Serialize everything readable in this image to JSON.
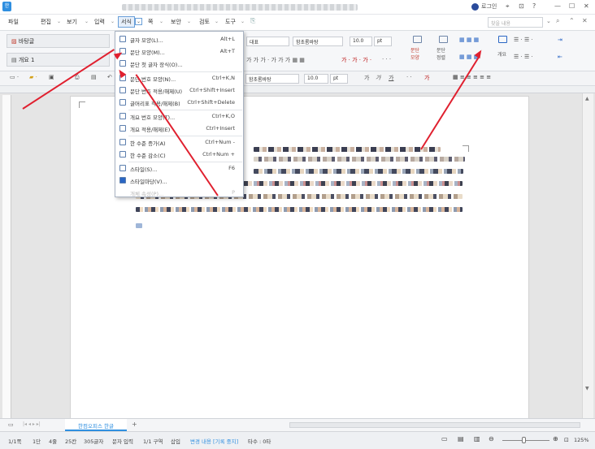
{
  "titlebar": {
    "login_label": "로그인"
  },
  "menu": {
    "items": [
      "파일",
      "편집",
      "보기",
      "입력",
      "서식",
      "쪽",
      "보안",
      "검토",
      "도구"
    ],
    "active": "서식",
    "search_placeholder": "찾을 내용"
  },
  "ribbon": {
    "style_1": "바탕글",
    "style_2": "개요 1",
    "style_name_field": "대표",
    "font_field": "함초롬바탕",
    "size_field": "10.0",
    "size_unit": "pt",
    "paragraph_btn": "문단\n모양",
    "align_btn": "문단\n정렬",
    "outline_btn": "개요",
    "tb2_font": "함초롬바탕",
    "tb2_size": "10.0",
    "tb2_unit": "pt",
    "text_ga": "가"
  },
  "dropdown": {
    "items": [
      {
        "label": "글자 모양(L)...",
        "shortcut": "Alt+L"
      },
      {
        "label": "문단 모양(M)...",
        "shortcut": "Alt+T"
      },
      {
        "label": "문단 첫 글자 장식(O)...",
        "shortcut": ""
      },
      {
        "label": "문단 번호 모양(N)...",
        "shortcut": "Ctrl+K,N"
      },
      {
        "label": "문단 번호 적용/해제(U)",
        "shortcut": "Ctrl+Shift+Insert"
      },
      {
        "label": "글머리표 적용/해제(B)",
        "shortcut": "Ctrl+Shift+Delete"
      },
      {
        "label": "개요 번호 모양(T)...",
        "shortcut": "Ctrl+K,O"
      },
      {
        "label": "개요 적용/해제(E)",
        "shortcut": "Ctrl+Insert"
      },
      {
        "label": "한 수준 증가(A)",
        "shortcut": "Ctrl+Num -"
      },
      {
        "label": "한 수준 감소(C)",
        "shortcut": "Ctrl+Num +"
      },
      {
        "label": "스타일(S)...",
        "shortcut": "F6"
      },
      {
        "label": "스타일마당(V)...",
        "shortcut": ""
      },
      {
        "label": "개체 속성(P)...",
        "shortcut": "P"
      }
    ]
  },
  "tabbar": {
    "doc_tab": "한컴오피스 한글",
    "add": "+"
  },
  "status": {
    "page": "1/1쪽",
    "section": "1단",
    "line": "4줄",
    "col": "25칸",
    "chars": "305글자",
    "input_mode": "문자 입력",
    "zone": "1/1 구역",
    "insert": "삽입",
    "track": "변경 내용 [기록 중지]",
    "typo": "타수 : 0타",
    "zoom": "125%"
  },
  "colors": {
    "accent": "#2f8fe0",
    "arrow": "#e0202f",
    "active_menu": "#6a9fd8"
  }
}
